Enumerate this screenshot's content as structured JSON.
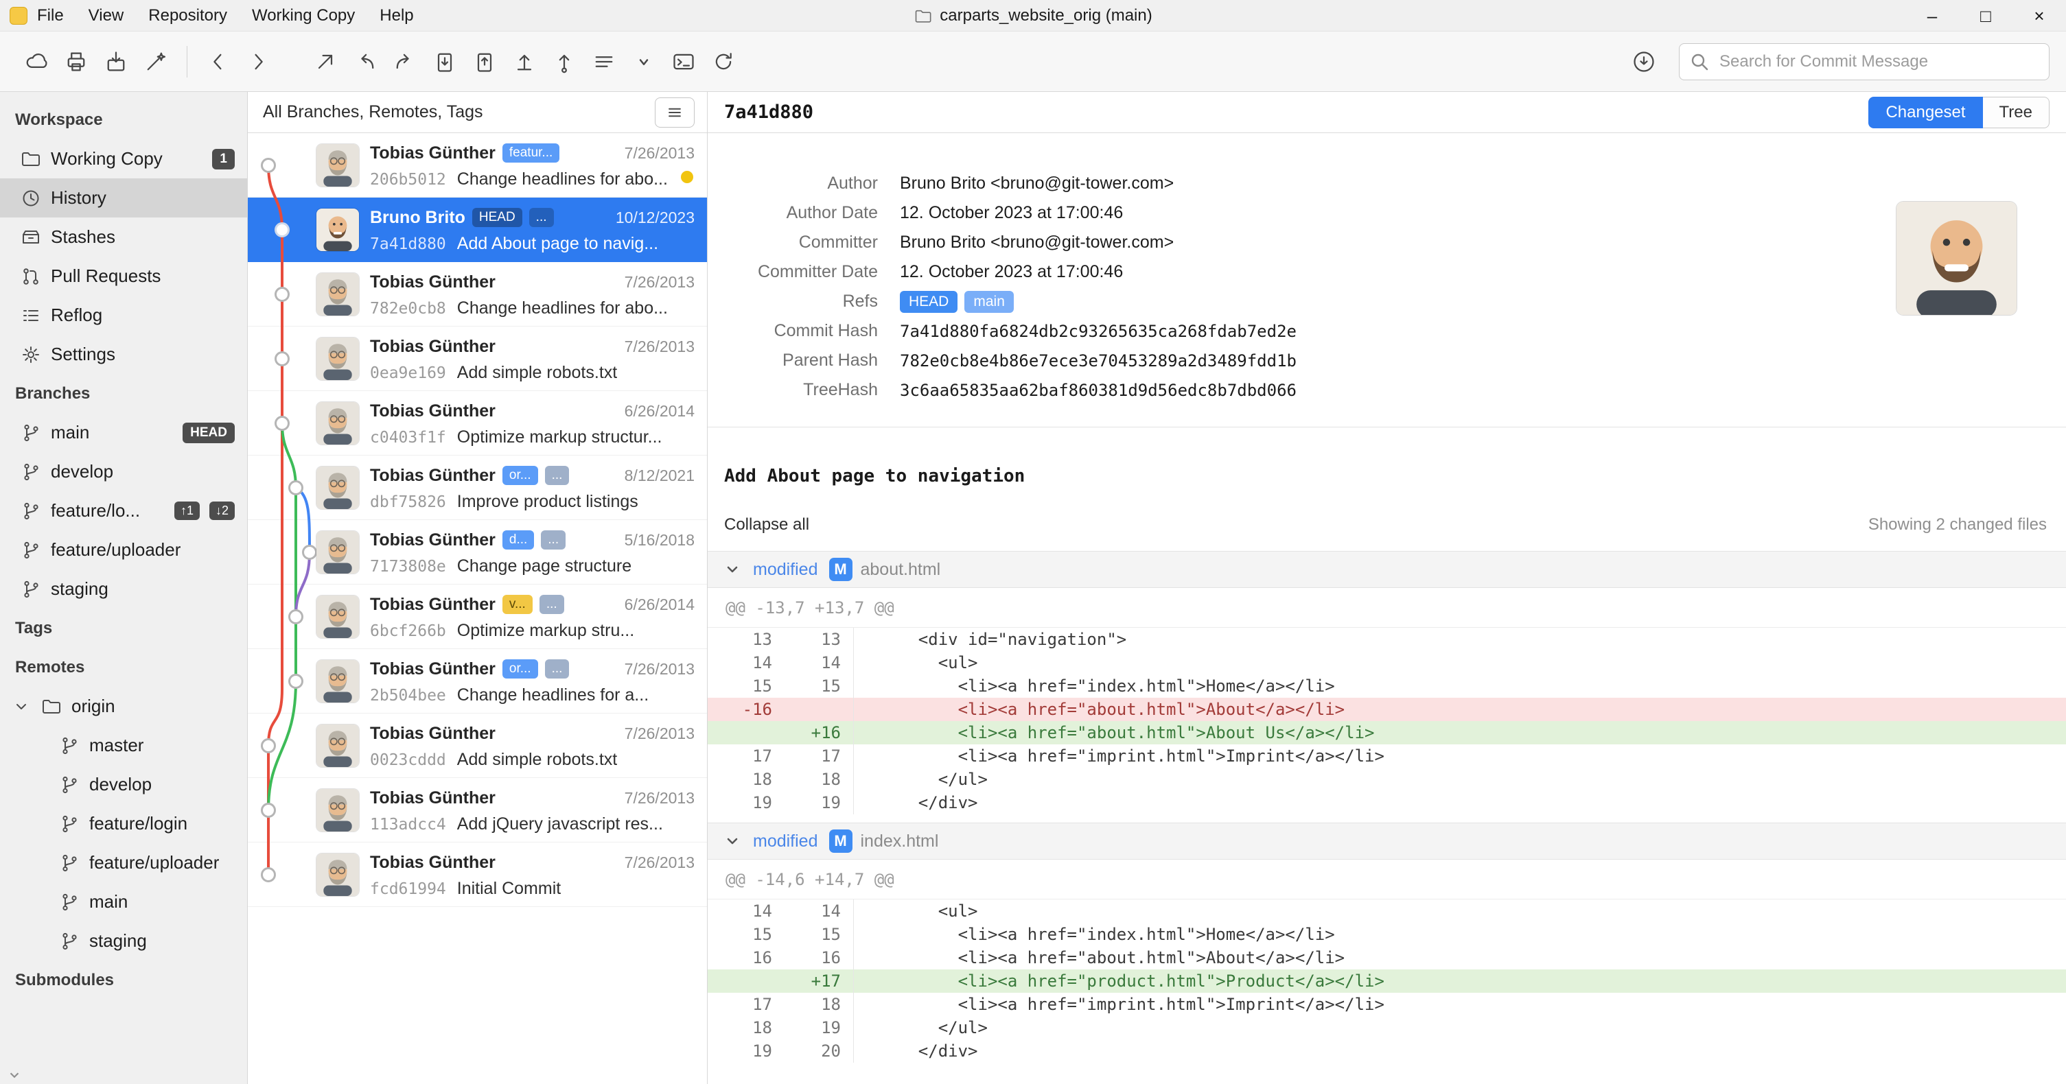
{
  "window": {
    "menus": [
      "File",
      "View",
      "Repository",
      "Working Copy",
      "Help"
    ],
    "title": "carparts_website_orig (main)",
    "minimize": "–",
    "maximize": "□",
    "close": "×"
  },
  "toolbar": {
    "search_placeholder": "Search for Commit Message"
  },
  "sidebar": {
    "workspace": {
      "label": "Workspace",
      "items": [
        {
          "label": "Working Copy",
          "badge": "1"
        },
        {
          "label": "History"
        },
        {
          "label": "Stashes"
        },
        {
          "label": "Pull Requests"
        },
        {
          "label": "Reflog"
        },
        {
          "label": "Settings"
        }
      ]
    },
    "branches": {
      "label": "Branches",
      "items": [
        {
          "label": "main",
          "badge": "HEAD"
        },
        {
          "label": "develop"
        },
        {
          "label": "feature/lo...",
          "counts": [
            "↑1",
            "↓2"
          ]
        },
        {
          "label": "feature/uploader"
        },
        {
          "label": "staging"
        }
      ]
    },
    "tags_label": "Tags",
    "remotes": {
      "label": "Remotes",
      "origin": "origin",
      "items": [
        "master",
        "develop",
        "feature/login",
        "feature/uploader",
        "main",
        "staging"
      ]
    },
    "submodules_label": "Submodules"
  },
  "commit_list": {
    "filter_label": "All Branches, Remotes, Tags",
    "commits": [
      {
        "author": "Tobias Günther",
        "badges": [
          {
            "text": "featur..."
          }
        ],
        "date": "7/26/2013",
        "hash": "206b5012",
        "message": "Change headlines for abo..."
      },
      {
        "author": "Bruno Brito",
        "badges": [
          {
            "text": "HEAD"
          },
          {
            "text": "..."
          }
        ],
        "date": "10/12/2023",
        "hash": "7a41d880",
        "message": "Add About page to navig..."
      },
      {
        "author": "Tobias Günther",
        "badges": [],
        "date": "7/26/2013",
        "hash": "782e0cb8",
        "message": "Change headlines for abo..."
      },
      {
        "author": "Tobias Günther",
        "badges": [],
        "date": "7/26/2013",
        "hash": "0ea9e169",
        "message": "Add simple robots.txt"
      },
      {
        "author": "Tobias Günther",
        "badges": [],
        "date": "6/26/2014",
        "hash": "c0403f1f",
        "message": "Optimize markup structur..."
      },
      {
        "author": "Tobias Günther",
        "badges": [
          {
            "text": "or..."
          },
          {
            "text": "..."
          }
        ],
        "date": "8/12/2021",
        "hash": "dbf75826",
        "message": "Improve product listings"
      },
      {
        "author": "Tobias Günther",
        "badges": [
          {
            "text": "d..."
          },
          {
            "text": "..."
          }
        ],
        "date": "5/16/2018",
        "hash": "7173808e",
        "message": "Change page structure"
      },
      {
        "author": "Tobias Günther",
        "badges": [
          {
            "text": "v..."
          },
          {
            "text": "..."
          }
        ],
        "date": "6/26/2014",
        "hash": "6bcf266b",
        "message": "Optimize markup stru..."
      },
      {
        "author": "Tobias Günther",
        "badges": [
          {
            "text": "or..."
          },
          {
            "text": "..."
          }
        ],
        "date": "7/26/2013",
        "hash": "2b504bee",
        "message": "Change headlines for a..."
      },
      {
        "author": "Tobias Günther",
        "badges": [],
        "date": "7/26/2013",
        "hash": "0023cddd",
        "message": "Add simple robots.txt"
      },
      {
        "author": "Tobias Günther",
        "badges": [],
        "date": "7/26/2013",
        "hash": "113adcc4",
        "message": "Add jQuery javascript res..."
      },
      {
        "author": "Tobias Günther",
        "badges": [],
        "date": "7/26/2013",
        "hash": "fcd61994",
        "message": "Initial Commit"
      }
    ]
  },
  "detail": {
    "short_hash": "7a41d880",
    "view_buttons": {
      "changeset": "Changeset",
      "tree": "Tree"
    },
    "meta": {
      "author_label": "Author",
      "author": "Bruno Brito <bruno@git-tower.com>",
      "author_date_label": "Author Date",
      "author_date": "12. October 2023 at 17:00:46",
      "committer_label": "Committer",
      "committer": "Bruno Brito <bruno@git-tower.com>",
      "committer_date_label": "Committer Date",
      "committer_date": "12. October 2023 at 17:00:46",
      "refs_label": "Refs",
      "refs": [
        "HEAD",
        "main"
      ],
      "commit_hash_label": "Commit Hash",
      "commit_hash": "7a41d880fa6824db2c93265635ca268fdab7ed2e",
      "parent_hash_label": "Parent Hash",
      "parent_hash": "782e0cb8e4b86e7ece3e70453289a2d3489fdd1b",
      "tree_hash_label": "TreeHash",
      "tree_hash": "3c6aa65835aa62baf860381d9d56edc8b7dbd066"
    },
    "message": "Add About page to navigation",
    "collapse_all": "Collapse all",
    "changed_files_label": "Showing 2 changed files",
    "files": [
      {
        "status": "modified",
        "badge": "M",
        "name": "about.html",
        "hunk": "@@ -13,7 +13,7 @@",
        "lines": [
          {
            "old": "13",
            "new": "13",
            "code": "    <div id=\"navigation\">"
          },
          {
            "old": "14",
            "new": "14",
            "code": "      <ul>"
          },
          {
            "old": "15",
            "new": "15",
            "code": "        <li><a href=\"index.html\">Home</a></li>"
          },
          {
            "old": "-16",
            "new": "",
            "code": "        <li><a href=\"about.html\">About</a></li>"
          },
          {
            "old": "",
            "new": "+16",
            "code": "        <li><a href=\"about.html\">About Us</a></li>"
          },
          {
            "old": "17",
            "new": "17",
            "code": "        <li><a href=\"imprint.html\">Imprint</a></li>"
          },
          {
            "old": "18",
            "new": "18",
            "code": "      </ul>"
          },
          {
            "old": "19",
            "new": "19",
            "code": "    </div>"
          }
        ]
      },
      {
        "status": "modified",
        "badge": "M",
        "name": "index.html",
        "hunk": "@@ -14,6 +14,7 @@",
        "lines": [
          {
            "old": "14",
            "new": "14",
            "code": "      <ul>"
          },
          {
            "old": "15",
            "new": "15",
            "code": "        <li><a href=\"index.html\">Home</a></li>"
          },
          {
            "old": "16",
            "new": "16",
            "code": "        <li><a href=\"about.html\">About</a></li>"
          },
          {
            "old": "",
            "new": "+17",
            "code": "        <li><a href=\"product.html\">Product</a></li>"
          },
          {
            "old": "17",
            "new": "18",
            "code": "        <li><a href=\"imprint.html\">Imprint</a></li>"
          },
          {
            "old": "18",
            "new": "19",
            "code": "      </ul>"
          },
          {
            "old": "19",
            "new": "20",
            "code": "    </div>"
          }
        ]
      }
    ]
  },
  "colors": {
    "accent": "#2e7bf0",
    "badge_blue": "#5b9cf8",
    "badge_yellow": "#f2c744",
    "graph_red": "#e74c3c",
    "graph_green": "#3dbb58",
    "graph_blue": "#4285f4",
    "graph_purple": "#8e6cc8",
    "added_bg": "#e2f2da",
    "removed_bg": "#fbe1e1"
  }
}
